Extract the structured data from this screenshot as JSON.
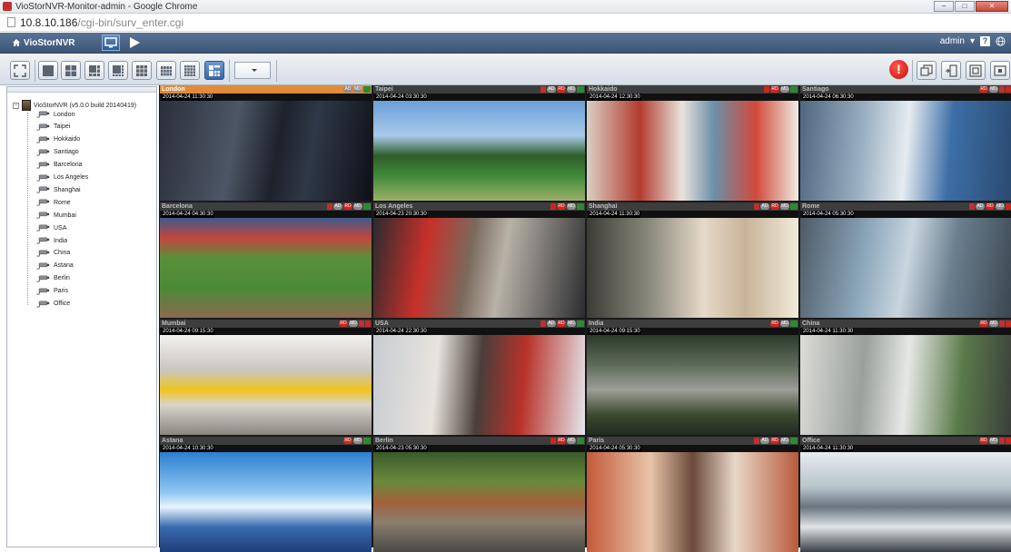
{
  "browser": {
    "window_title": "VioStorNVR-Monitor-admin - Google Chrome",
    "url_host": "10.8.10.186",
    "url_path": "/cgi-bin/surv_enter.cgi",
    "window_buttons": [
      "‒",
      "□",
      "✕"
    ]
  },
  "header": {
    "brand": "VioStorNVR",
    "user": "admin",
    "user_caret": "▾",
    "help_label": "?"
  },
  "toolbar": {
    "alert_label": "!",
    "layout_dropdown_value": ""
  },
  "tree": {
    "root_label": "VioStorNVR (v5.0.0 build 20140419)",
    "expander": "−",
    "cameras": [
      "London",
      "Taipei",
      "Hokkaido",
      "Santiago",
      "Barcelona",
      "Los Angeles",
      "Shanghai",
      "Rome",
      "Mumbai",
      "USA",
      "India",
      "China",
      "Astana",
      "Berlin",
      "Paris",
      "Office"
    ]
  },
  "cameras": [
    {
      "name": "London",
      "ts": "2014-04-24 11:30:30",
      "badges": [
        "AD",
        "MD",
        "sig"
      ],
      "selected": true
    },
    {
      "name": "Taipei",
      "ts": "2014-04-24 03:30:30",
      "badges": [
        "spk",
        "AD",
        "RD",
        "MD",
        "sig"
      ]
    },
    {
      "name": "Hokkaido",
      "ts": "2014-04-24 12:30:30",
      "badges": [
        "rec",
        "RD",
        "MD",
        "sig"
      ]
    },
    {
      "name": "Santiago",
      "ts": "2014-04-24 06:30:30",
      "badges": [
        "RD",
        "MD",
        "spk",
        "rec"
      ]
    },
    {
      "name": "Barcelona",
      "ts": "2014-04-24 04:30:30",
      "badges": [
        "spk",
        "AD",
        "RD",
        "MD",
        "sig"
      ]
    },
    {
      "name": "Los Angeles",
      "ts": "2014-04-23 20:30:30",
      "badges": [
        "rec",
        "RD",
        "MD",
        "sig"
      ]
    },
    {
      "name": "Shanghai",
      "ts": "2014-04-24 11:30:30",
      "badges": [
        "spk",
        "AD",
        "RD",
        "MD",
        "sig"
      ]
    },
    {
      "name": "Rome",
      "ts": "2014-04-24 05:30:30",
      "badges": [
        "spk",
        "AD",
        "RD",
        "MD",
        "rec"
      ]
    },
    {
      "name": "Mumbai",
      "ts": "2014-04-24 09:15:30",
      "badges": [
        "RD",
        "MD",
        "spk",
        "rec"
      ]
    },
    {
      "name": "USA",
      "ts": "2014-04-24 22:30:30",
      "badges": [
        "spk",
        "AD",
        "RD",
        "MD",
        "sig"
      ]
    },
    {
      "name": "India",
      "ts": "2014-04-24 09:15:30",
      "badges": [
        "RD",
        "MD",
        "sig"
      ]
    },
    {
      "name": "China",
      "ts": "2014-04-24 11:30:30",
      "badges": [
        "RD",
        "MD",
        "spk",
        "rec"
      ]
    },
    {
      "name": "Astana",
      "ts": "2014-04-24 10:30:30",
      "badges": [
        "RD",
        "MD",
        "sig"
      ]
    },
    {
      "name": "Berlin",
      "ts": "2014-04-23 05:30:30",
      "badges": [
        "rec",
        "RD",
        "MD",
        "sig"
      ]
    },
    {
      "name": "Paris",
      "ts": "2014-04-24 05:30:30",
      "badges": [
        "spk",
        "AD",
        "RD",
        "MD",
        "sig"
      ]
    },
    {
      "name": "Office",
      "ts": "2014-04-24 11:30:30",
      "badges": [
        "RD",
        "MD",
        "spk",
        "rec"
      ]
    }
  ],
  "colors": {
    "header_bg": "#3c5678",
    "selected_cell": "#e08a3a",
    "alert": "#d2261e"
  }
}
